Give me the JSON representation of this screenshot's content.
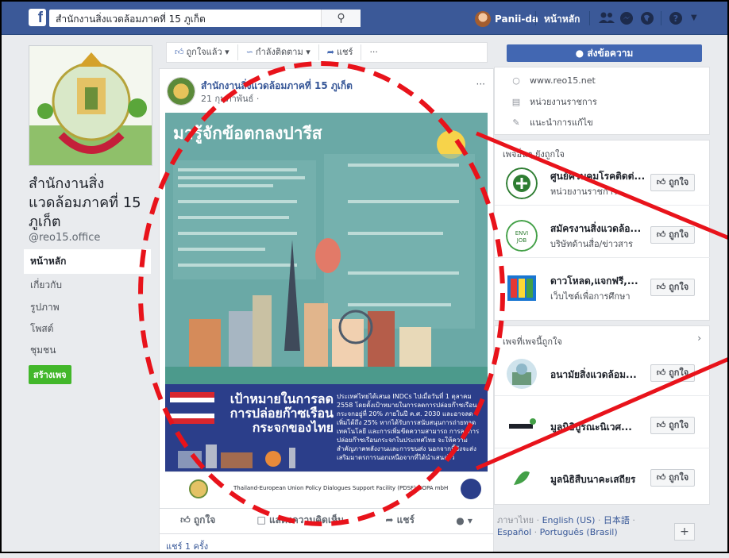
{
  "topbar": {
    "search_value": "สำนักงานสิ่งแวดล้อมภาคที่ 15 ภูเก็ต",
    "user_name": "Panii-da",
    "home_label": "หน้าหลัก"
  },
  "page": {
    "name": "สำนักงานสิ่งแวดล้อมภาคที่ 15 ภูเก็ต",
    "handle": "@reo15.office",
    "nav": [
      "หน้าหลัก",
      "เกี่ยวกับ",
      "รูปภาพ",
      "โพสต์",
      "ชุมชน"
    ],
    "create_button": "สร้างเพจ"
  },
  "actions": {
    "liked": "ถูกใจแล้ว",
    "following": "กำลังติดตาม",
    "share": "แชร์",
    "more": "···"
  },
  "post": {
    "author": "สำนักงานสิ่งแวดล้อมภาคที่ 15 ภูเก็ต",
    "date": "21 กุมภาพันธ์ ·",
    "more": "···",
    "infographic_title": "มารู้จักข้อตกลงปารีส",
    "banner_title": "เป้าหมายในการลดการปล่อยก๊าซเรือนกระจกของไทย",
    "banner_text": "ประเทศไทยได้เสนอ INDCs ไปเมื่อวันที่ 1 ตุลาคม 2558 โดยตั้งเป้าหมายในการลดการปล่อยก๊าซเรือนกระจกอยู่ที่ 20% ภายในปี ค.ศ. 2030 และอาจลดเพิ่มได้ถึง 25% หากได้รับการสนับสนุนการถ่ายทอดเทคโนโลยี และการเพิ่มขีดความสามารถ การลดการปล่อยก๊าซเรือนกระจกในประเทศไทย จะให้ความสำคัญภาคพลังงานและการขนส่ง นอกจากนี้ยังจะส่งเสริมมาตรการนอกเหนือจากที่ได้นำเสนอไว้",
    "footer_text": "Thailand-European Union Policy Dialogues Support Facility (PDSF) GOPA mbH",
    "like": "ถูกใจ",
    "comment": "แสดงความคิดเห็น",
    "share": "แชร์",
    "shares_count": "แชร์ 1 ครั้ง"
  },
  "right": {
    "send_message": "ส่งข้อความ",
    "website": "www.reo15.net",
    "category": "หน่วยงานราชการ",
    "suggest_edit": "แนะนำการแก้ไข",
    "others_like_header": "เพจอื่นๆ ยังถูกใจ",
    "others_like": [
      {
        "name": "ศูนย์ควบคุมโรคติดต่...",
        "sub": "หน่วยงานราชการ"
      },
      {
        "name": "สมัครงานสิ่งแวดล้อ...",
        "sub": "บริษัทด้านสื่อ/ข่าวสาร"
      },
      {
        "name": "ดาวโหลด,แจกฟรี,...",
        "sub": "เว็บไซต์เพื่อการศึกษา"
      }
    ],
    "liked_pages_header": "เพจที่เพจนี้ถูกใจ",
    "liked_pages": [
      {
        "name": "อนามัยสิ่งแวดล้อม..."
      },
      {
        "name": "มูลนิธิบูรณะนิเวศ..."
      },
      {
        "name": "มูลนิธิสืบนาคะเสถียร"
      }
    ],
    "like_label": "ถูกใจ",
    "languages_prefix": "ภาษาไทย ·",
    "lang_english": "English (US)",
    "lang_japanese": "日本語",
    "lang_spanish": "Español",
    "lang_portuguese": "Português (Brasil)"
  }
}
